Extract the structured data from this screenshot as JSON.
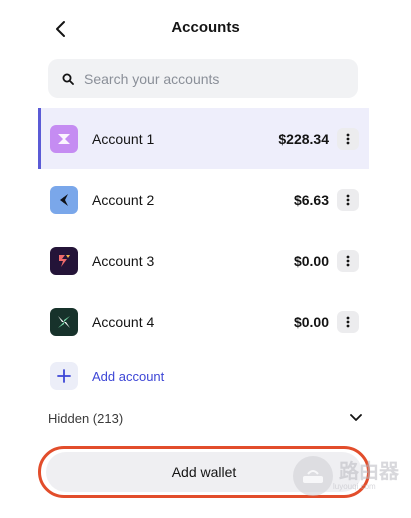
{
  "header": {
    "title": "Accounts"
  },
  "search": {
    "placeholder": "Search your accounts"
  },
  "accounts": [
    {
      "name": "Account 1",
      "balance": "$228.34",
      "selected": true,
      "color": "#c58cf2"
    },
    {
      "name": "Account 2",
      "balance": "$6.63",
      "selected": false,
      "color": "#7aa7ea"
    },
    {
      "name": "Account 3",
      "balance": "$0.00",
      "selected": false,
      "color": "#241438"
    },
    {
      "name": "Account 4",
      "balance": "$0.00",
      "selected": false,
      "color": "#17322b"
    }
  ],
  "add_account": {
    "label": "Add account"
  },
  "hidden": {
    "label": "Hidden (213)"
  },
  "add_wallet": {
    "label": "Add wallet"
  },
  "watermark": {
    "text": "路由器",
    "sub": "luyouqi.com"
  },
  "colors": {
    "accent": "#5b5bd6",
    "link": "#3d46d6",
    "highlight_border": "#e24d2b"
  }
}
